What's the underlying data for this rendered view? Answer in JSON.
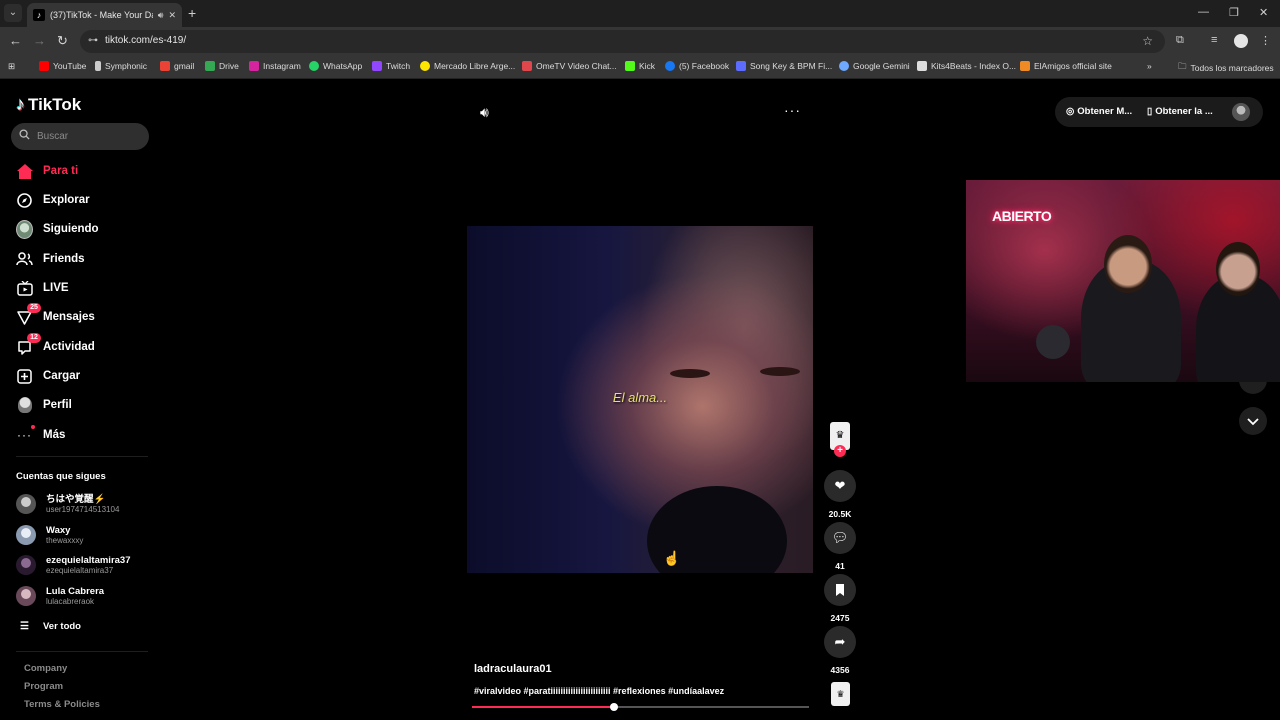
{
  "browser": {
    "tab": {
      "title": "(37)TikTok - Make Your Day",
      "favicon": "tiktok-favicon"
    },
    "url": "tiktok.com/es-419/",
    "bookmarks": [
      {
        "label": "YouTube",
        "color": "#ff0000"
      },
      {
        "label": "Symphonic",
        "color": "#cccccc"
      },
      {
        "label": "gmail",
        "color": "#ea4335"
      },
      {
        "label": "Drive",
        "color": "#34a853"
      },
      {
        "label": "Instagram",
        "color": "#d6249f"
      },
      {
        "label": "WhatsApp",
        "color": "#25d366"
      },
      {
        "label": "Twitch",
        "color": "#9146ff"
      },
      {
        "label": "Mercado Libre Arge...",
        "color": "#ffe600"
      },
      {
        "label": "OmeTV Video Chat...",
        "color": "#e0474c"
      },
      {
        "label": "Kick",
        "color": "#53fc18"
      },
      {
        "label": "(5) Facebook",
        "color": "#1877f2"
      },
      {
        "label": "Song Key & BPM Fi...",
        "color": "#5b6cff"
      },
      {
        "label": "Google Gemini",
        "color": "#6ea8ff"
      },
      {
        "label": "Kits4Beats - Index O...",
        "color": "#dddddd"
      },
      {
        "label": "ElAmigos official site",
        "color": "#f08a24"
      }
    ],
    "all_bookmarks": "Todos los marcadores"
  },
  "sidebar": {
    "logo": "TikTok",
    "search_placeholder": "Buscar",
    "nav": [
      {
        "label": "Para ti",
        "icon": "home-icon"
      },
      {
        "label": "Explorar",
        "icon": "compass-icon"
      },
      {
        "label": "Siguiendo",
        "icon": "following-avatar-icon"
      },
      {
        "label": "Friends",
        "icon": "friends-icon"
      },
      {
        "label": "LIVE",
        "icon": "live-icon"
      },
      {
        "label": "Mensajes",
        "icon": "messages-icon",
        "badge": "25"
      },
      {
        "label": "Actividad",
        "icon": "activity-icon",
        "badge": "12"
      },
      {
        "label": "Cargar",
        "icon": "upload-icon"
      },
      {
        "label": "Perfil",
        "icon": "profile-icon"
      },
      {
        "label": "Más",
        "icon": "more-icon"
      }
    ],
    "following_title": "Cuentas que sigues",
    "following": [
      {
        "name": "ちはや覚醒⚡",
        "handle": "user1974714513104",
        "color": "#6b6b6b"
      },
      {
        "name": "Waxy",
        "handle": "thewaxxxy",
        "color": "#8a9ab0"
      },
      {
        "name": "ezequielaltamira37",
        "handle": "ezequielaltamira37",
        "color": "#3a2a40"
      },
      {
        "name": "Lula Cabrera",
        "handle": "lulacabreraok",
        "color": "#8a6a7a"
      }
    ],
    "see_all": "Ver todo",
    "footer": [
      "Company",
      "Program",
      "Terms & Policies"
    ]
  },
  "header": {
    "get_coins": "Obtener M...",
    "get_app": "Obtener la ..."
  },
  "video": {
    "caption": "El alma...",
    "author": "ladraculaura01",
    "description": "#viralvideo #paratiiiiiiiiiiiiiiiiiiiiiiii #reflexiones #undíaalavez",
    "progress": 0.42,
    "likes": "20.5K",
    "comments": "41",
    "saves": "2475",
    "shares": "4356"
  },
  "stream_overlay": {
    "sign": "ABIERTO"
  }
}
